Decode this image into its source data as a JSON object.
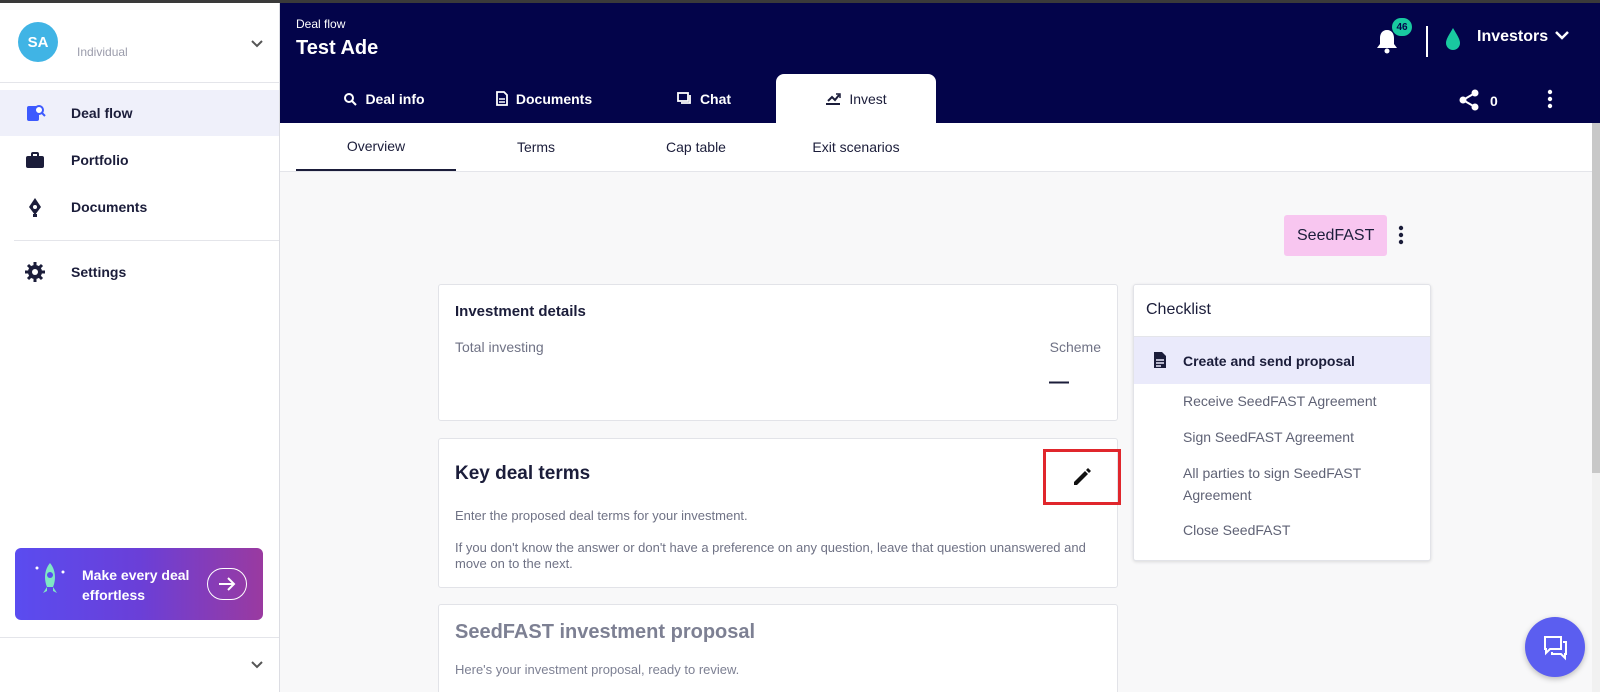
{
  "account": {
    "initials": "SA",
    "type": "Individual"
  },
  "sidebar": {
    "items": [
      {
        "label": "Deal flow",
        "icon": "deal-flow-icon",
        "active": true
      },
      {
        "label": "Portfolio",
        "icon": "briefcase-icon"
      },
      {
        "label": "Documents",
        "icon": "pen-nib-icon"
      },
      {
        "label": "Settings",
        "icon": "gear-icon"
      }
    ],
    "promo": {
      "text": "Make every deal effortless",
      "icon": "rocket-icon",
      "arrow": "arrow-right-icon"
    }
  },
  "header": {
    "breadcrumb": "Deal flow",
    "title": "Test Ade",
    "notification_count": "46",
    "workspace": "Investors",
    "share_count": "0",
    "tabs": [
      {
        "label": "Deal info",
        "icon": "search-icon"
      },
      {
        "label": "Documents",
        "icon": "document-icon"
      },
      {
        "label": "Chat",
        "icon": "chat-icon"
      },
      {
        "label": "Invest",
        "icon": "invest-icon",
        "active": true
      }
    ]
  },
  "subtabs": [
    {
      "label": "Overview",
      "active": true
    },
    {
      "label": "Terms"
    },
    {
      "label": "Cap table"
    },
    {
      "label": "Exit scenarios"
    }
  ],
  "main": {
    "scheme_chip": "SeedFAST",
    "investment_details": {
      "title": "Investment details",
      "total_label": "Total investing",
      "scheme_label": "Scheme",
      "scheme_value": "—"
    },
    "key_deal_terms": {
      "title": "Key deal terms",
      "p1": "Enter the proposed deal terms for your investment.",
      "p2": "If you don't know the answer or don't have a preference on any question, leave that question unanswered and move on to the next."
    },
    "proposal": {
      "title": "SeedFAST investment proposal",
      "subtitle": "Here's your investment proposal, ready to review."
    },
    "checklist": {
      "title": "Checklist",
      "items": [
        "Create and send proposal",
        "Receive SeedFAST Agreement",
        "Sign SeedFAST Agreement",
        "All parties to sign SeedFAST Agreement",
        "Close SeedFAST"
      ]
    }
  },
  "colors": {
    "header_bg": "#03044a",
    "accent": "#5b5ef0",
    "chip_bg": "#f8c6f0",
    "badge": "#19c9a0",
    "highlight_box": "#e0262c"
  }
}
